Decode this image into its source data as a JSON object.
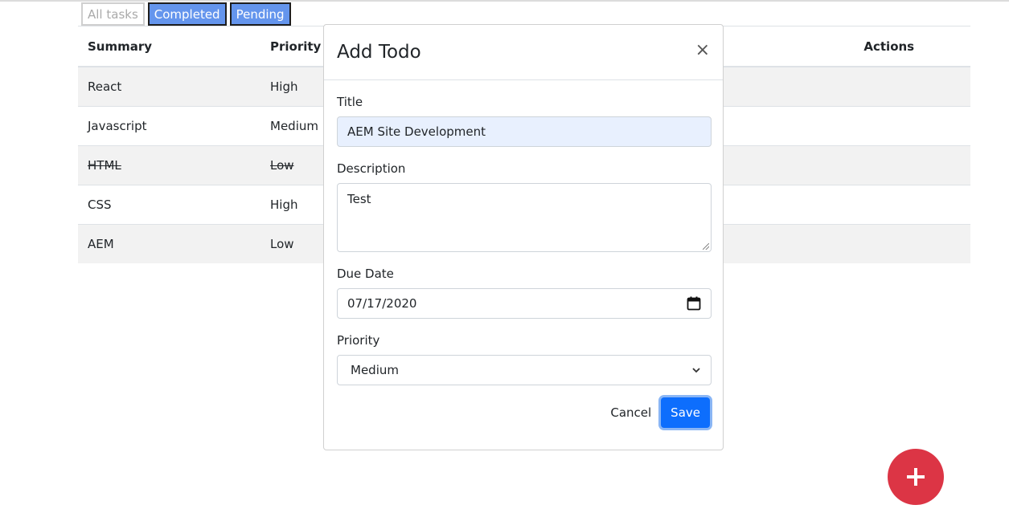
{
  "filters": {
    "all": "All tasks",
    "completed": "Completed",
    "pending": "Pending"
  },
  "table": {
    "headers": {
      "summary": "Summary",
      "priority": "Priority",
      "actions": "Actions"
    },
    "rows": [
      {
        "summary": "React",
        "priority": "High",
        "completed": false
      },
      {
        "summary": "Javascript",
        "priority": "Medium",
        "completed": false
      },
      {
        "summary": "HTML",
        "priority": "Low",
        "completed": true
      },
      {
        "summary": "CSS",
        "priority": "High",
        "completed": false
      },
      {
        "summary": "AEM",
        "priority": "Low",
        "completed": false
      }
    ]
  },
  "modal": {
    "title": "Add Todo",
    "close": "×",
    "fields": {
      "title_label": "Title",
      "title_value": "AEM Site Development",
      "description_label": "Description",
      "description_value": "Test",
      "due_date_label": "Due Date",
      "due_date_value": "07/17/2020",
      "priority_label": "Priority",
      "priority_value": "Medium"
    },
    "cancel_label": "Cancel",
    "save_label": "Save"
  },
  "icons": {
    "calendar": "calendar-icon",
    "chevron": "chevron-down-icon",
    "add": "plus-icon",
    "close": "close-icon"
  },
  "colors": {
    "filter_active": "#6495ed",
    "save": "#0d6efd",
    "fab": "#dc3545",
    "title_bg": "#e8f0fe"
  }
}
